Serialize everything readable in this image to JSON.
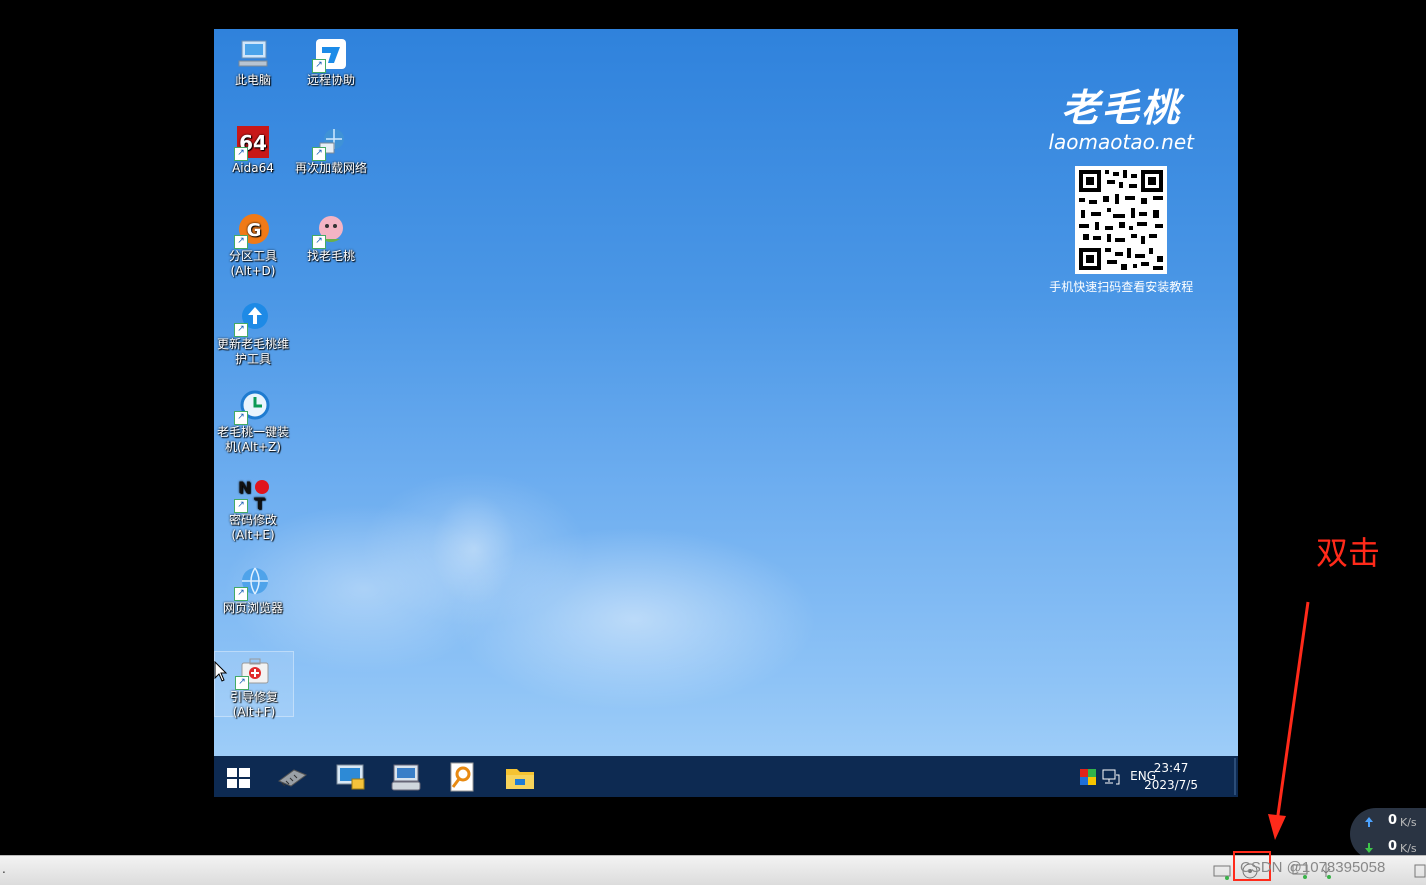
{
  "desktop": {
    "icons": [
      {
        "label": "此电脑",
        "icon": "computer-icon"
      },
      {
        "label": "远程协助",
        "icon": "remote-assist-icon"
      },
      {
        "label": "Aida64",
        "icon": "aida64-icon"
      },
      {
        "label": "再次加载网络",
        "icon": "network-reload-icon"
      },
      {
        "label": "分区工具\n(Alt+D)",
        "icon": "partition-tool-icon"
      },
      {
        "label": "找老毛桃",
        "icon": "find-laomaotao-icon"
      },
      {
        "label": "更新老毛桃维\n护工具",
        "icon": "update-tool-icon"
      },
      {
        "label": "老毛桃一键装\n机(Alt+Z)",
        "icon": "one-click-install-icon"
      },
      {
        "label": "密码修改\n(Alt+E)",
        "icon": "password-change-icon"
      },
      {
        "label": "网页浏览器",
        "icon": "web-browser-icon"
      },
      {
        "label": "引导修复\n(Alt+F)",
        "icon": "boot-repair-icon"
      }
    ]
  },
  "brand": {
    "chinese": "老毛桃",
    "url": "laomaotao.net",
    "qr_caption": "手机快速扫码查看安装教程"
  },
  "taskbar": {
    "apps": [
      "start-icon",
      "memory-chip-icon",
      "monitor-tool-icon",
      "keyboard-icon",
      "search-disk-icon",
      "file-explorer-icon"
    ],
    "language": "ENG",
    "time": "23:47",
    "date": "2023/7/5"
  },
  "annotation": {
    "text": "双击",
    "color": "#ff2a1a"
  },
  "host": {
    "net_up": "0",
    "net_down": "0",
    "net_unit": "K/s",
    "watermark": "CSDN @1078395058"
  }
}
